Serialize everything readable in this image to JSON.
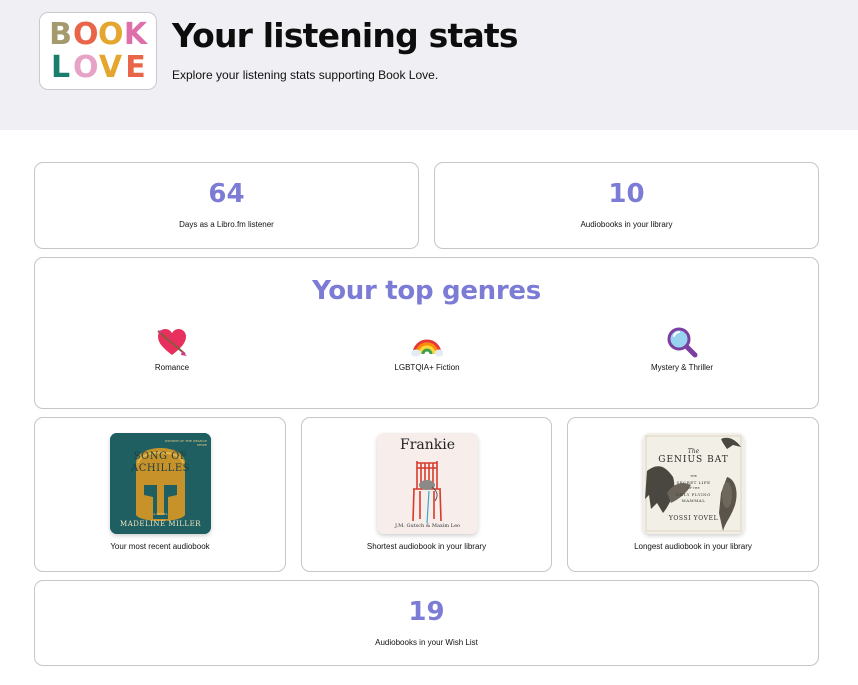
{
  "header": {
    "logo_letters_top": [
      "B",
      "O",
      "O",
      "K"
    ],
    "logo_letters_bottom": [
      "L",
      "O",
      "V",
      "E"
    ],
    "title": "Your listening stats",
    "subtitle": "Explore your listening stats supporting Book Love."
  },
  "stats": {
    "days": {
      "value": "64",
      "label": "Days as a Libro.fm listener"
    },
    "library": {
      "value": "10",
      "label": "Audiobooks in your library"
    },
    "wishlist": {
      "value": "19",
      "label": "Audiobooks in your Wish List"
    }
  },
  "genres": {
    "title": "Your top genres",
    "items": [
      {
        "label": "Romance",
        "icon": "heart-arrow-icon"
      },
      {
        "label": "LGBTQIA+ Fiction",
        "icon": "rainbow-icon"
      },
      {
        "label": "Mystery & Thriller",
        "icon": "magnifying-glass-icon"
      }
    ]
  },
  "books": [
    {
      "caption": "Your most recent audiobook",
      "cover_title_1": "SONG OF",
      "cover_title_2": "ACHILLES",
      "cover_author": "MADELINE MILLER",
      "cover_blurb": "WINNER OF THE ORANGE PRIZE",
      "cover_tag": "A NOVEL"
    },
    {
      "caption": "Shortest audiobook in your library",
      "cover_title": "Frankie",
      "cover_author": "J.M. Gutsch & Maxim Leo"
    },
    {
      "caption": "Longest audiobook in your library",
      "cover_the": "The",
      "cover_title": "GENIUS BAT",
      "cover_sub_1": "THE",
      "cover_sub_2": "SECRET LIFE",
      "cover_sub_3": "OF THE",
      "cover_sub_4": "ONLY FLYING",
      "cover_sub_5": "MAMMAL",
      "cover_author": "YOSSI YOVEL"
    }
  ],
  "colors": {
    "accent": "#7c7cd6",
    "header_bg": "#efeff4",
    "card_border": "#c6c6c6",
    "logo_letters": [
      "#a49a6e",
      "#e9654a",
      "#e4a62f",
      "#de6faa",
      "#1a7f6a",
      "#e7a3c5",
      "#e4a62f",
      "#e9654a"
    ]
  }
}
